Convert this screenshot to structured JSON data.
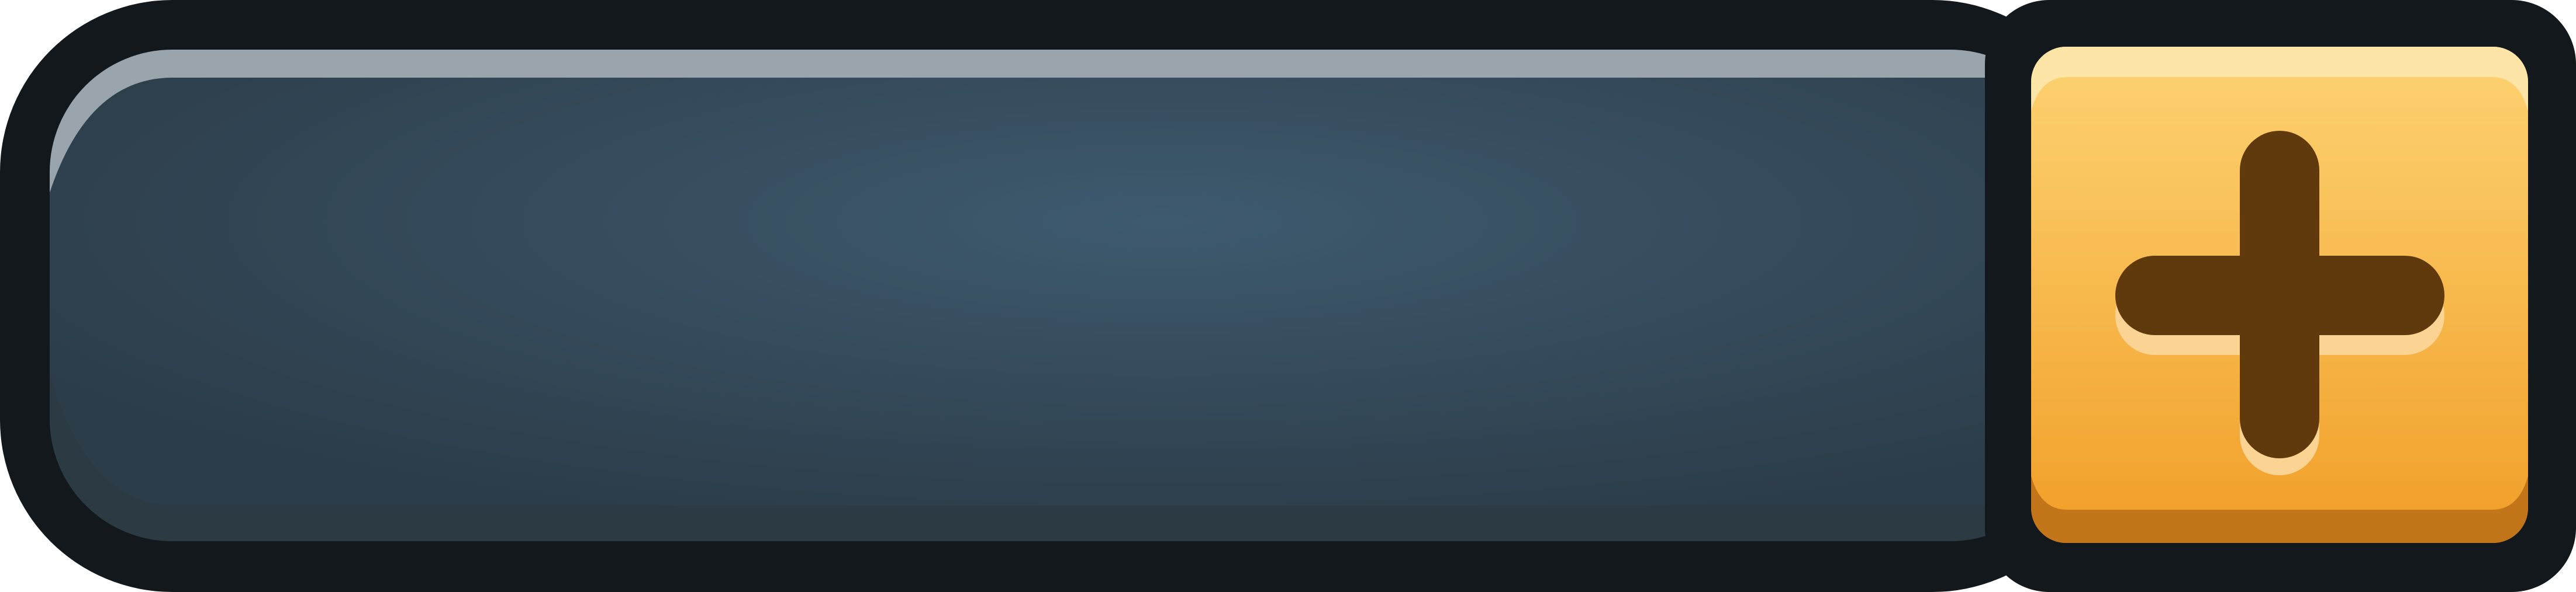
{
  "widget": {
    "kind": "currency-bar",
    "value_text": "",
    "add_button": {
      "icon": "plus-icon"
    }
  },
  "colors": {
    "outline": "#12181b",
    "panel_center": "#3e5a6f",
    "panel_edge": "#2c3c48",
    "panel_highlight": "#9aa4ad",
    "panel_shadow": "#2b3a43",
    "button_top": "#fdd373",
    "button_bottom": "#f19e27",
    "button_highlight": "#fde5a7",
    "button_shadow": "#c27519",
    "plus_color": "#603a0c",
    "plus_shadow": "#fbd393"
  }
}
